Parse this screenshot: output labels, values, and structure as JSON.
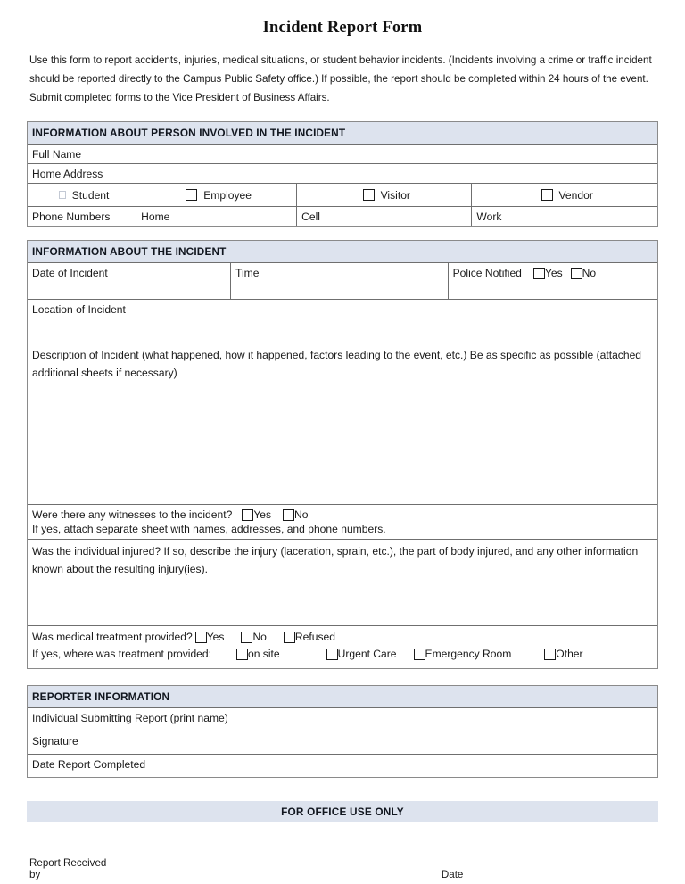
{
  "document": {
    "title": "Incident Report Form",
    "intro": "Use this form to report accidents, injuries, medical situations, or student behavior incidents. (Incidents involving a crime or traffic incident should be reported directly to the Campus Public Safety office.) If possible, the report should be completed within 24 hours of the event. Submit completed forms to the Vice President of Business Affairs.",
    "band_color": "#dde3ee",
    "border_color": "#6f6f6f"
  },
  "person_section": {
    "heading": "INFORMATION ABOUT PERSON INVOLVED IN THE INCIDENT",
    "full_name_label": "Full Name",
    "home_address_label": "Home Address",
    "roles": [
      {
        "label": "Student",
        "checked": false,
        "style": "faint"
      },
      {
        "label": "Employee",
        "checked": false,
        "style": "bold"
      },
      {
        "label": "Visitor",
        "checked": false,
        "style": "bold"
      },
      {
        "label": "Vendor",
        "checked": false,
        "style": "bold"
      }
    ],
    "phone_label": "Phone Numbers",
    "phone_fields": [
      "Home",
      "Cell",
      "Work"
    ]
  },
  "incident_section": {
    "heading": "INFORMATION ABOUT THE INCIDENT",
    "date_label": "Date of Incident",
    "time_label": "Time",
    "police_label": "Police Notified",
    "police_options": [
      {
        "label": "Yes",
        "checked": false
      },
      {
        "label": "No",
        "checked": false
      }
    ],
    "location_label": "Location of Incident",
    "description_label": "Description of Incident (what happened, how it happened, factors leading to the event, etc.) Be as specific as possible (attached additional sheets if necessary)",
    "witness_question": "Were there any witnesses to the incident?",
    "witness_options": [
      {
        "label": "Yes",
        "checked": false
      },
      {
        "label": "No",
        "checked": false
      }
    ],
    "witness_note": "If yes, attach separate sheet with names, addresses, and phone numbers.",
    "injury_question": "Was the individual injured? If so, describe the injury (laceration, sprain, etc.), the part of body injured, and any other information known about the resulting injury(ies).",
    "treatment_question": "Was medical treatment provided?",
    "treatment_options": [
      {
        "label": "Yes",
        "checked": false
      },
      {
        "label": "No",
        "checked": false
      },
      {
        "label": "Refused",
        "checked": false
      }
    ],
    "treatment_location_question": "If yes, where was treatment provided:",
    "treatment_locations": [
      {
        "label": "on site",
        "checked": false
      },
      {
        "label": "Urgent Care",
        "checked": false
      },
      {
        "label": "Emergency Room",
        "checked": false
      },
      {
        "label": "Other",
        "checked": false
      }
    ]
  },
  "reporter_section": {
    "heading": "REPORTER INFORMATION",
    "rows": [
      "Individual Submitting Report (print name)",
      "Signature",
      "Date Report Completed"
    ]
  },
  "office_section": {
    "heading": "FOR OFFICE USE ONLY",
    "received_by_label": "Report Received by",
    "date_label": "Date"
  }
}
